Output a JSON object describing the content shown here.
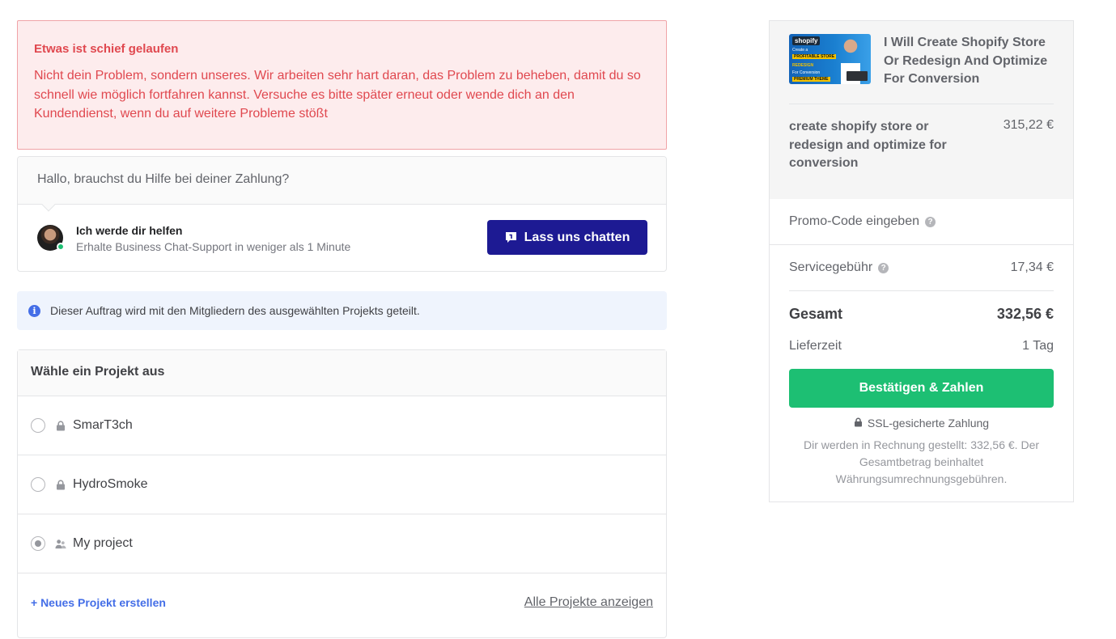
{
  "error": {
    "title": "Etwas ist schief gelaufen",
    "message": "Nicht dein Problem, sondern unseres. Wir arbeiten sehr hart daran, das Problem zu beheben, damit du so schnell wie möglich fortfahren kannst. Versuche es bitte später erneut oder wende dich an den Kundendienst, wenn du auf weitere Probleme stößt"
  },
  "help": {
    "question": "Hallo, brauchst du Hilfe bei deiner Zahlung?",
    "agent_title": "Ich werde dir helfen",
    "agent_subtitle": "Erhalte Business Chat-Support in weniger als 1 Minute",
    "chat_button": "Lass uns chatten"
  },
  "info": {
    "text": "Dieser Auftrag wird mit den Mitgliedern des ausgewählten Projekts geteilt."
  },
  "projects": {
    "heading": "Wähle ein Projekt aus",
    "items": [
      {
        "name": "SmarT3ch",
        "icon": "lock-icon",
        "selected": false
      },
      {
        "name": "HydroSmoke",
        "icon": "lock-icon",
        "selected": false
      },
      {
        "name": "My project",
        "icon": "users-icon",
        "selected": true
      }
    ],
    "new_project": "+ Neues Projekt erstellen",
    "show_all": "Alle Projekte anzeigen"
  },
  "summary": {
    "thumbnail": {
      "logo": "shopify",
      "line1": "Create a",
      "line2": "PROFITABLE STORE",
      "line3": "REDESIGN",
      "line4": "For Conversion",
      "line5": "PREMIUM THEME"
    },
    "gig_title": "I Will Create Shopify Store Or Redesign And Optimize For Conversion",
    "package_name": "create shopify store or redesign and optimize for conversion",
    "package_price": "315,22 €",
    "promo_label": "Promo-Code eingeben",
    "service_fee_label": "Servicegebühr",
    "service_fee_value": "17,34 €",
    "total_label": "Gesamt",
    "total_value": "332,56 €",
    "delivery_label": "Lieferzeit",
    "delivery_value": "1 Tag",
    "pay_button": "Bestätigen & Zahlen",
    "ssl_text": "SSL-gesicherte Zahlung",
    "billing_note": "Dir werden in Rechnung gestellt: 332,56 €. Der Gesamtbetrag beinhaltet Währungsumrechnungsgebühren."
  },
  "colors": {
    "error_text": "#e0484f",
    "chat_button": "#1d1a93",
    "pay_button": "#1dbf73",
    "link": "#446ee7",
    "info_bg": "#eff4fd"
  }
}
